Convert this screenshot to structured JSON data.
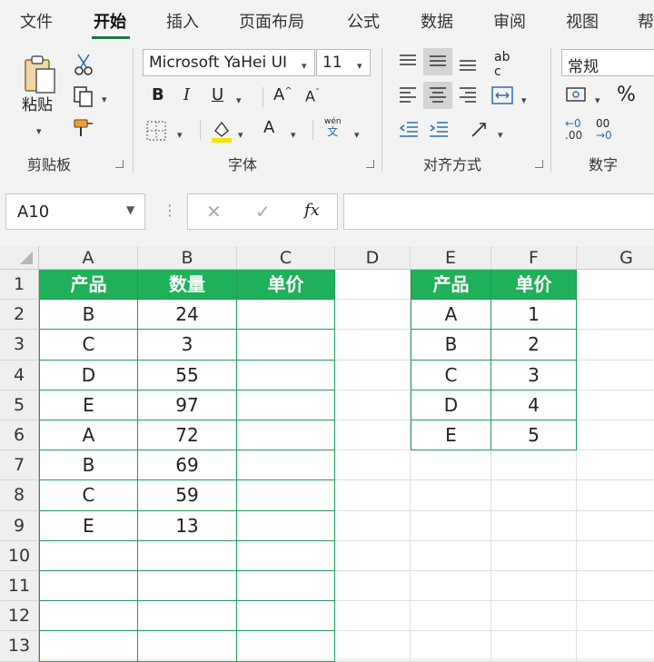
{
  "tabs": [
    "文件",
    "开始",
    "插入",
    "页面布局",
    "公式",
    "数据",
    "审阅",
    "视图",
    "帮"
  ],
  "active_tab": "开始",
  "clipboard": {
    "paste_label": "粘贴",
    "group_label": "剪贴板"
  },
  "font": {
    "family": "Microsoft YaHei UI",
    "size": "11",
    "bold": "B",
    "italic": "I",
    "underline": "U",
    "grow": "A",
    "shrink": "A",
    "font_color": "A",
    "phonetic_top": "wén",
    "phonetic_bottom": "文",
    "group_label": "字体"
  },
  "alignment": {
    "group_label": "对齐方式",
    "wrap_label": "ab",
    "wrap_sub": "c"
  },
  "number": {
    "format": "常规",
    "percent": "%",
    "inc_decimal": ".00",
    "dec_decimal": ".00",
    "inc_top": "←0",
    "dec_top": "00",
    "dec_bottom": "→0",
    "group_label": "数字"
  },
  "formula_bar": {
    "name_box": "A10",
    "cancel": "✕",
    "enter": "✓",
    "fx": "fx",
    "value": ""
  },
  "columns": [
    "A",
    "B",
    "C",
    "D",
    "E",
    "F",
    "G"
  ],
  "rows": [
    "1",
    "2",
    "3",
    "4",
    "5",
    "6",
    "7",
    "8",
    "9",
    "10",
    "11",
    "12",
    "13"
  ],
  "table1": {
    "headers": [
      "产品",
      "数量",
      "单价"
    ],
    "rows": [
      [
        "B",
        "24",
        ""
      ],
      [
        "C",
        "3",
        ""
      ],
      [
        "D",
        "55",
        ""
      ],
      [
        "E",
        "97",
        ""
      ],
      [
        "A",
        "72",
        ""
      ],
      [
        "B",
        "69",
        ""
      ],
      [
        "C",
        "59",
        ""
      ],
      [
        "E",
        "13",
        ""
      ],
      [
        "",
        "",
        ""
      ],
      [
        "",
        "",
        ""
      ],
      [
        "",
        "",
        ""
      ],
      [
        "",
        "",
        ""
      ]
    ]
  },
  "table2": {
    "headers": [
      "产品",
      "单价"
    ],
    "rows": [
      [
        "A",
        "1"
      ],
      [
        "B",
        "2"
      ],
      [
        "C",
        "3"
      ],
      [
        "D",
        "4"
      ],
      [
        "E",
        "5"
      ]
    ]
  },
  "colors": {
    "accent": "#217346",
    "header_fill": "#1fb05a",
    "table_border": "#1f9a5a"
  }
}
